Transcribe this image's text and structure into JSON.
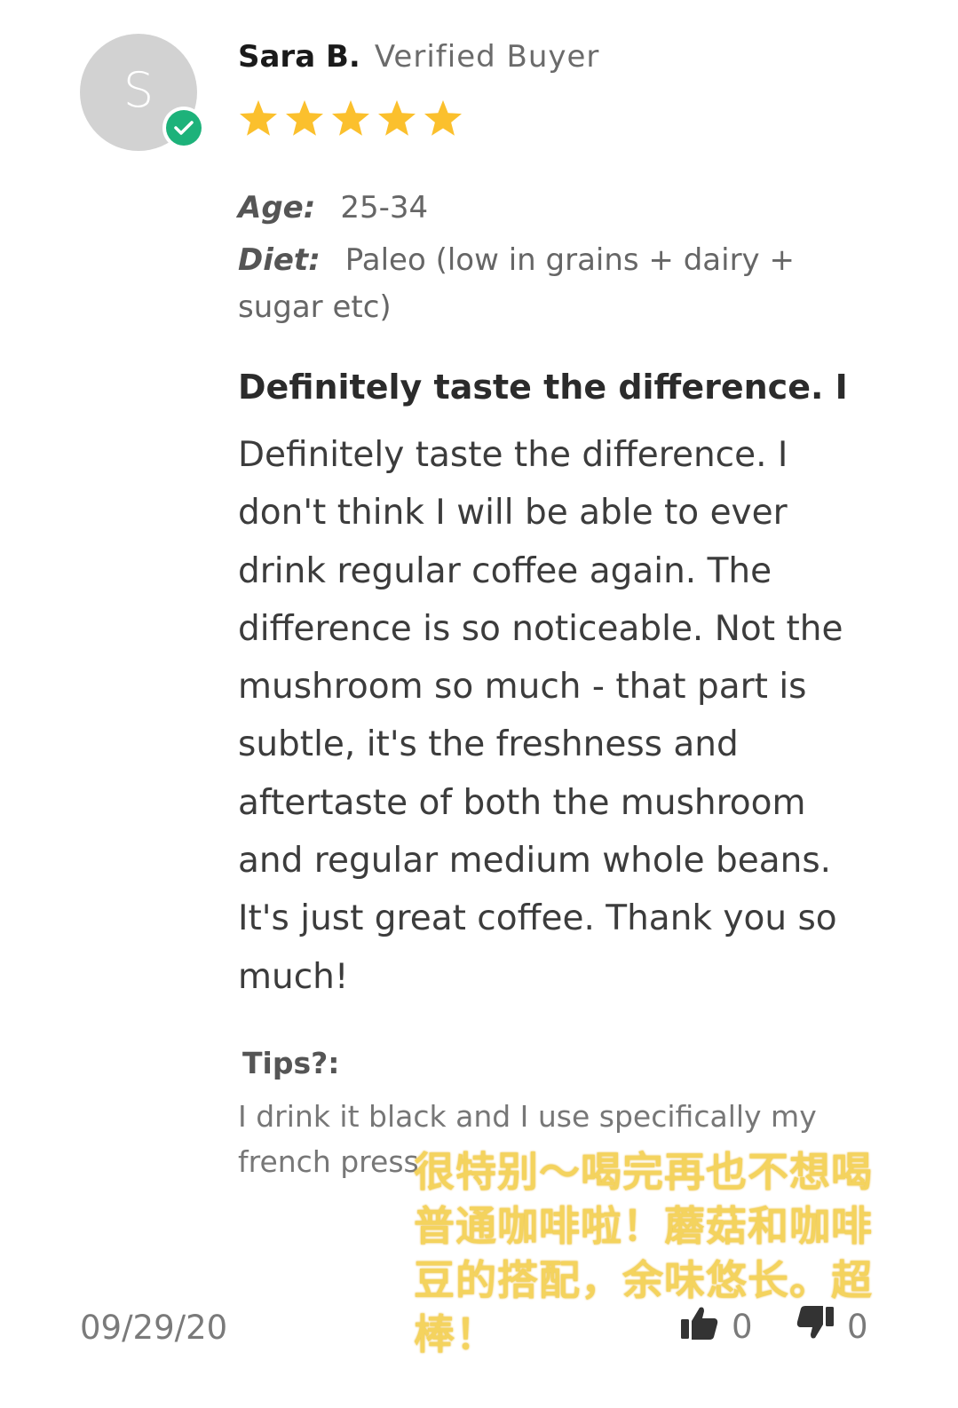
{
  "reviewer": {
    "initial": "S",
    "name": "Sara B.",
    "verified_label": "Verified Buyer",
    "rating": 5,
    "rating_max": 5
  },
  "attributes": {
    "age_label": "Age:",
    "age_value": "25-34",
    "diet_label": "Diet:",
    "diet_value": "Paleo (low in grains + dairy + sugar etc)"
  },
  "review": {
    "title": "Definitely taste the difference. I",
    "body": "Definitely taste the difference. I don't think I will be able to ever drink regular coffee again. The difference is so noticeable. Not the mushroom so much - that part is subtle, it's the freshness and aftertaste of both the mushroom and regular medium whole beans. It's just great coffee. Thank you so much!"
  },
  "tips": {
    "heading": "Tips?:",
    "body": "I drink it black and I use specifically my french press"
  },
  "overlay_caption": "很特别～喝完再也不想喝普通咖啡啦！蘑菇和咖啡豆的搭配，余味悠长。超棒！",
  "footer": {
    "date": "09/29/20",
    "helpful_count": "0",
    "unhelpful_count": "0"
  },
  "colors": {
    "star": "#fbc02d",
    "verified_badge": "#1db27a",
    "avatar_bg": "#d2d2d2",
    "overlay_text": "#f4d35e"
  },
  "icons": [
    "check-icon",
    "star-icon",
    "thumbs-up-icon",
    "thumbs-down-icon"
  ]
}
